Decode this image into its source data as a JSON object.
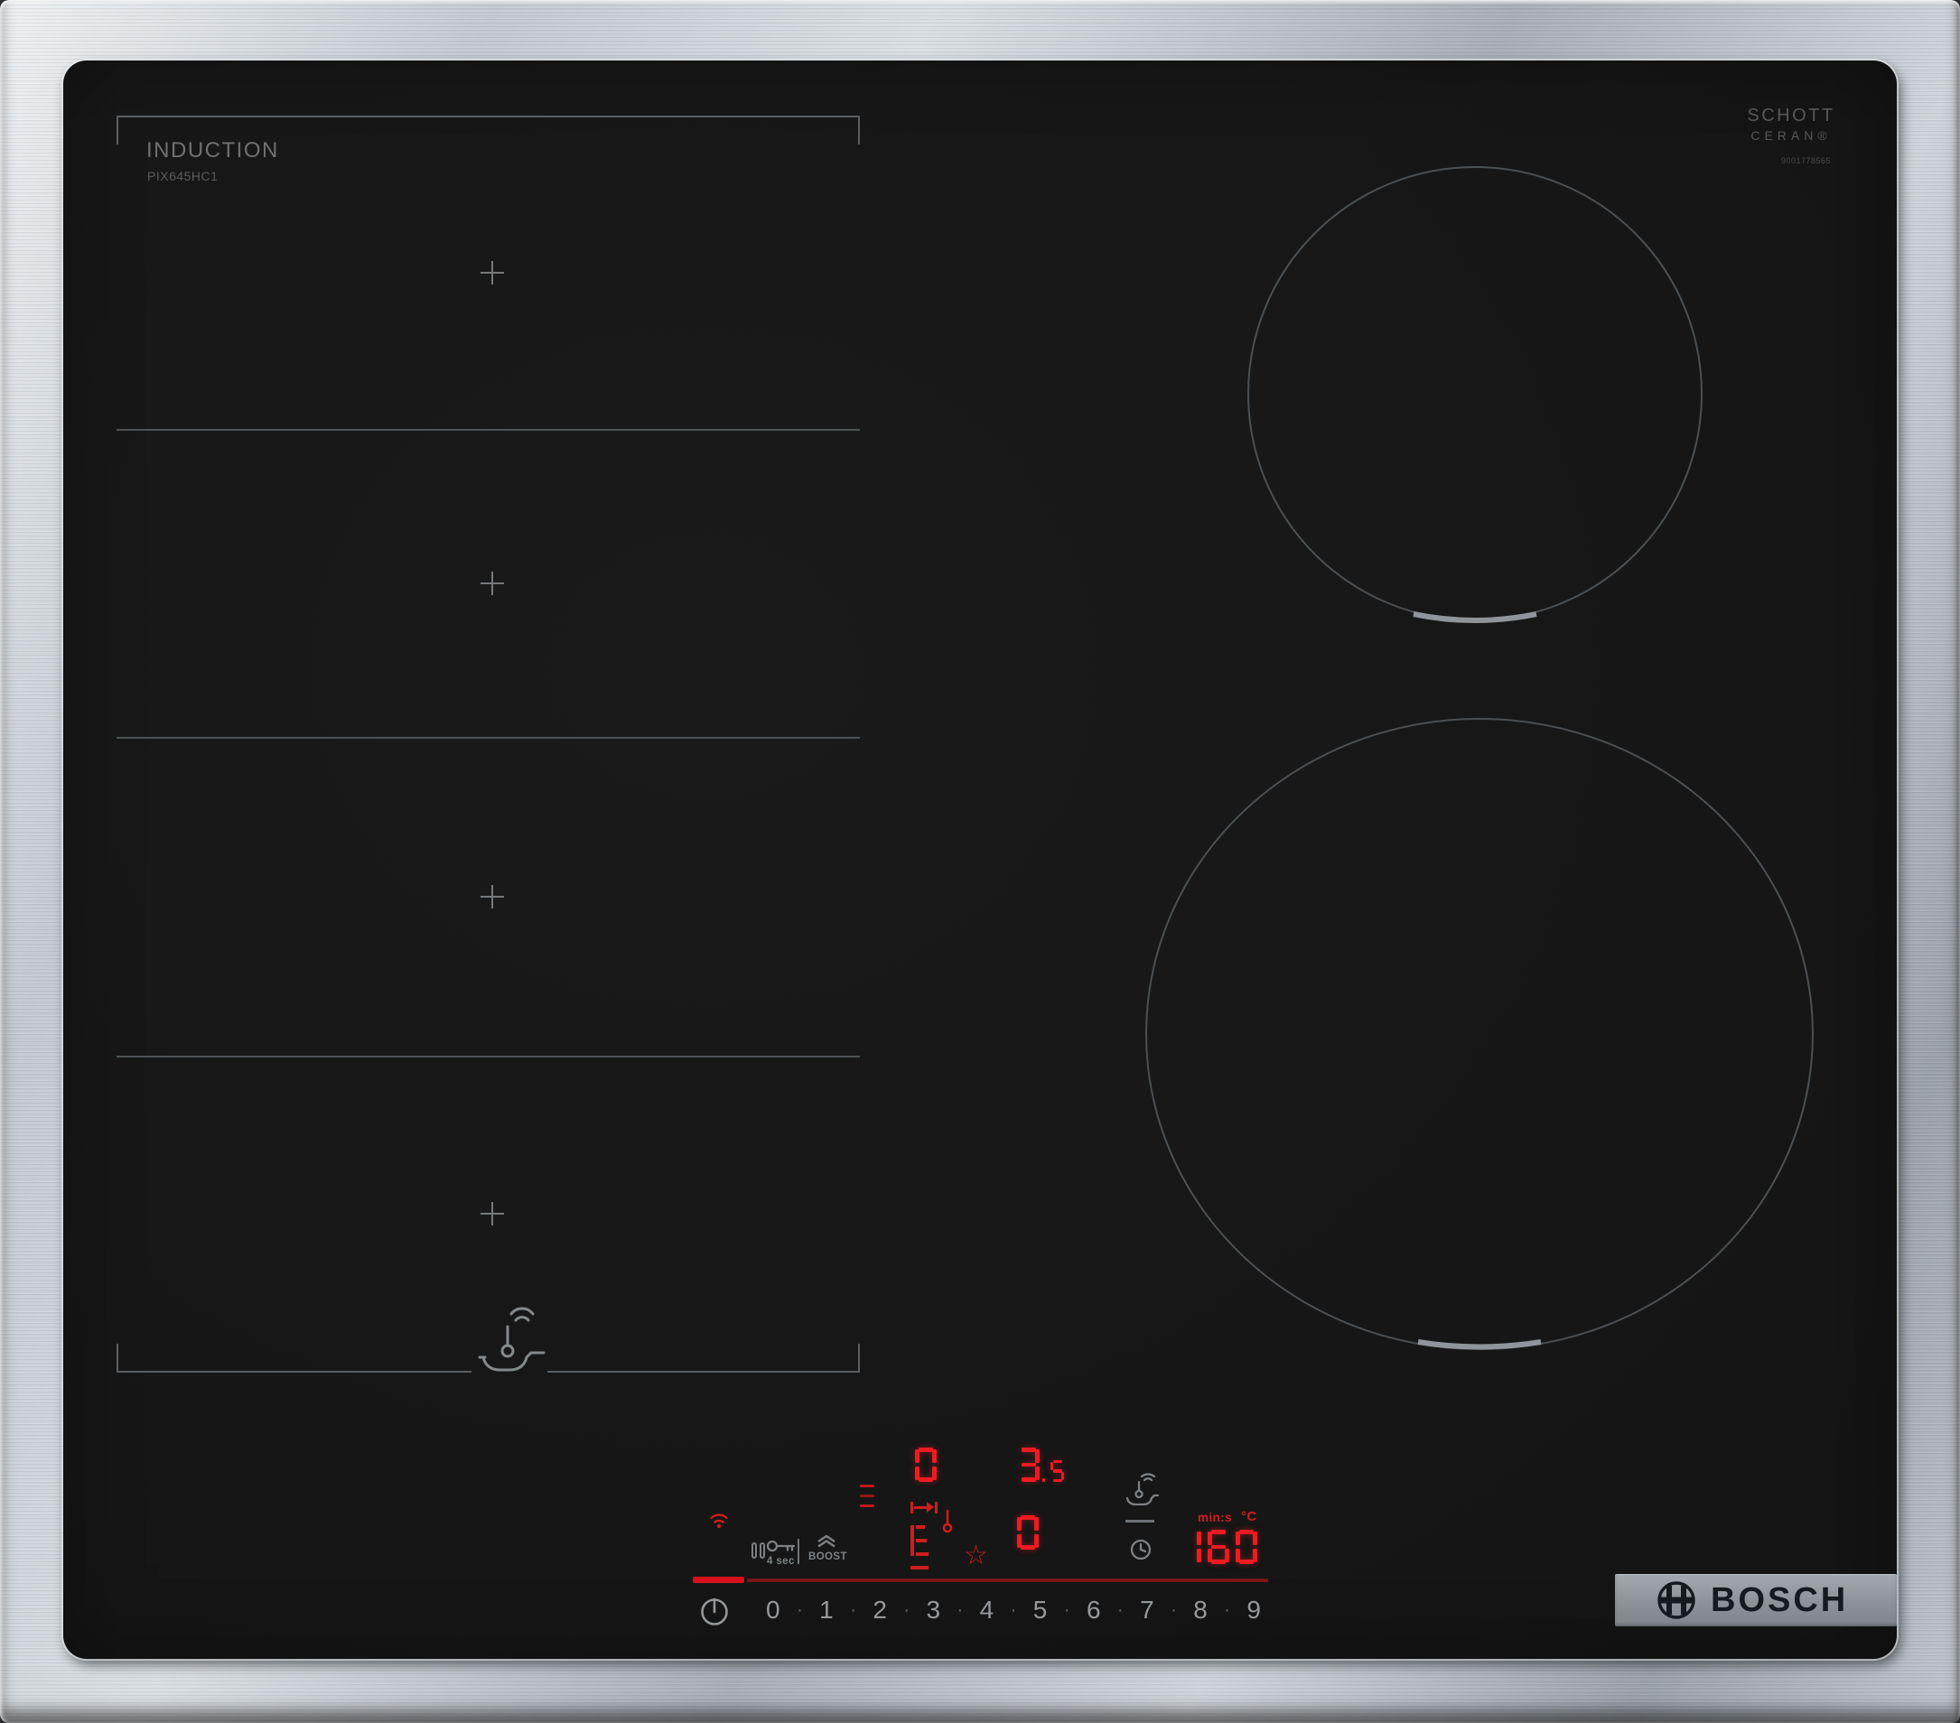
{
  "hob": {
    "zone_label": "INDUCTION",
    "model": "PIX645HC1",
    "glass_brand_line1": "SCHOTT",
    "glass_brand_line2": "CERAN®",
    "glass_code": "9001778565",
    "brand": "BOSCH"
  },
  "panel": {
    "lock_hold_label": "4 sec",
    "boost_label": "BOOST",
    "timer_unit_time": "min:s",
    "timer_unit_temp": "°C",
    "level_separator": "·",
    "power_levels": [
      "0",
      "1",
      "2",
      "3",
      "4",
      "5",
      "6",
      "7",
      "8",
      "9"
    ],
    "displays": {
      "top_left": "0",
      "top_right": "3",
      "top_right_decimal": ".5",
      "bottom_right": "0",
      "timer": "160"
    },
    "star_glyph": "☆",
    "icons": {
      "wifi": "home-connect-wifi",
      "pause": "pause",
      "key": "child-lock-key",
      "boost": "boost-chevrons",
      "zone_select": "zone-select-dashes",
      "pan_transfer": "pan-transfer-arrow",
      "fry_sensor": "frying-sensor-pan",
      "timer_clock": "timer-clock",
      "power": "power-standby",
      "flex_sensor": "wireless-temp-sensor-pan",
      "favorite": "favorite-star"
    },
    "colors": {
      "led_red": "#ee1b22",
      "accent_bar_red": "#d81019",
      "icon_gray": "#7d8184"
    }
  }
}
